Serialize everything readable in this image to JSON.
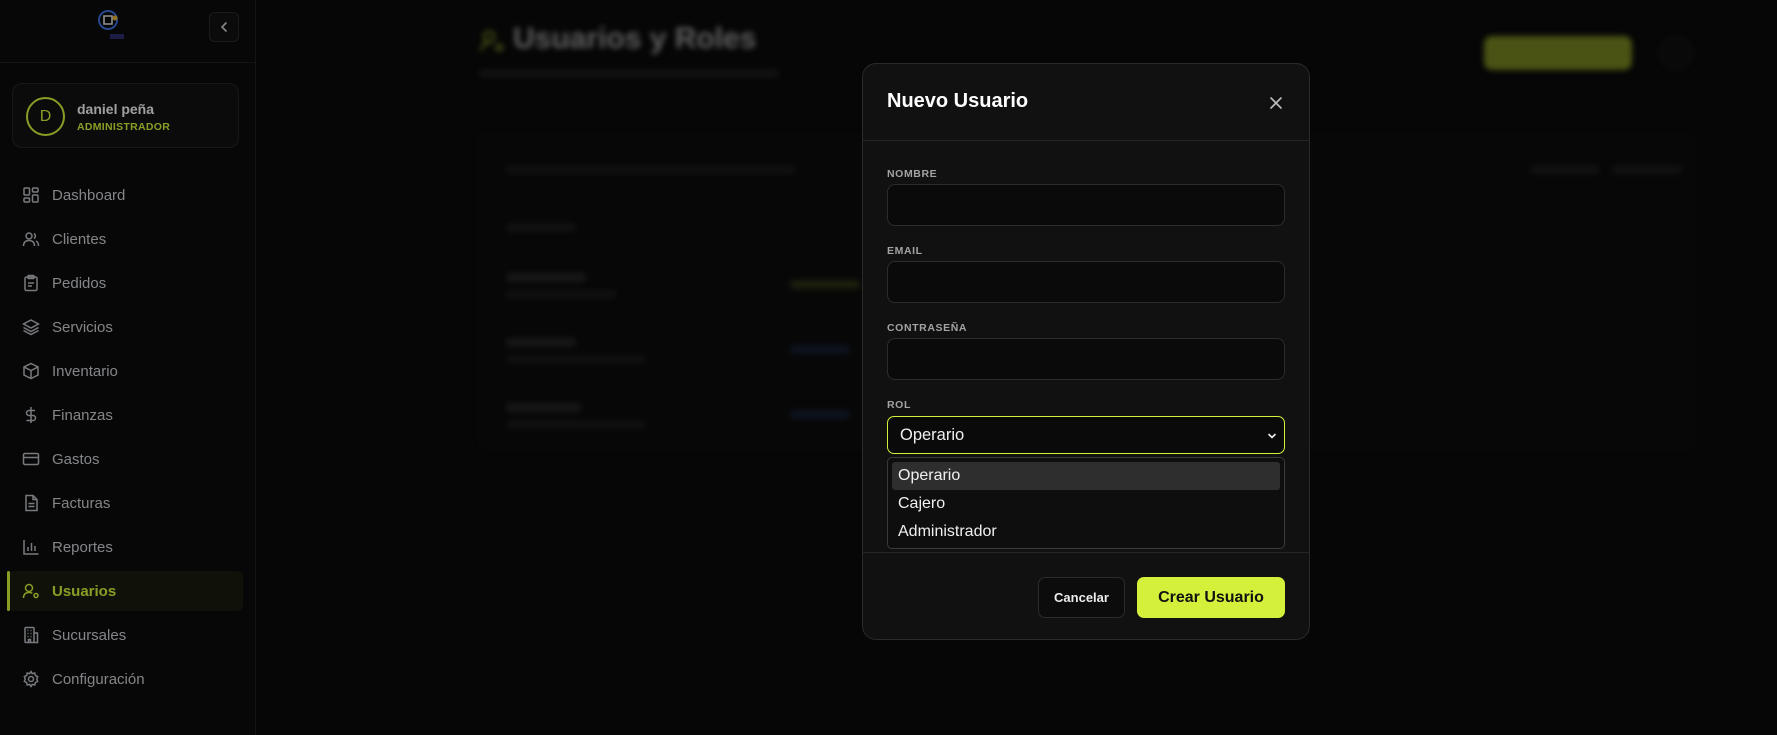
{
  "sidebar": {
    "logo": "app-logo",
    "user": {
      "initial": "D",
      "name": "daniel peña",
      "role": "ADMINISTRADOR"
    },
    "items": [
      {
        "label": "Dashboard",
        "icon": "dashboard-icon"
      },
      {
        "label": "Clientes",
        "icon": "users-icon"
      },
      {
        "label": "Pedidos",
        "icon": "clipboard-icon"
      },
      {
        "label": "Servicios",
        "icon": "layers-icon"
      },
      {
        "label": "Inventario",
        "icon": "box-icon"
      },
      {
        "label": "Finanzas",
        "icon": "dollar-icon"
      },
      {
        "label": "Gastos",
        "icon": "credit-card-icon"
      },
      {
        "label": "Facturas",
        "icon": "document-icon"
      },
      {
        "label": "Reportes",
        "icon": "bar-chart-icon"
      },
      {
        "label": "Usuarios",
        "icon": "user-cog-icon",
        "active": true
      },
      {
        "label": "Sucursales",
        "icon": "building-icon"
      },
      {
        "label": "Configuración",
        "icon": "gear-icon"
      }
    ]
  },
  "page": {
    "title": "Usuarios y Roles"
  },
  "modal": {
    "title": "Nuevo Usuario",
    "fields": {
      "name_label": "NOMBRE",
      "email_label": "EMAIL",
      "password_label": "CONTRASEÑA",
      "role_label": "ROL"
    },
    "role_selected": "Operario",
    "role_options": [
      "Operario",
      "Cajero",
      "Administrador"
    ],
    "cancel_label": "Cancelar",
    "create_label": "Crear Usuario"
  },
  "colors": {
    "accent": "#d4f03a",
    "background": "#0a0a0a"
  }
}
